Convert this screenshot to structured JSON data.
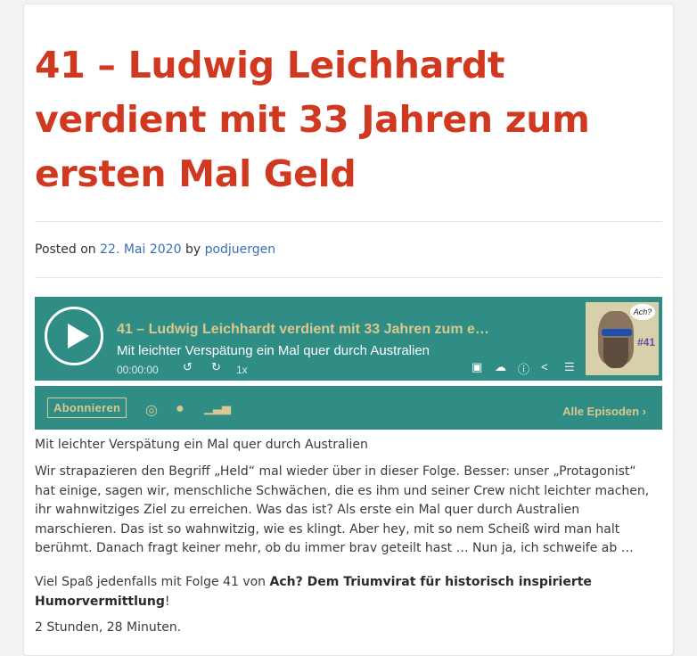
{
  "post": {
    "title": "41 – Ludwig Leichhardt verdient mit 33 Jahren zum ersten Mal Geld",
    "posted_on_label": "Posted on",
    "date": "22. Mai 2020",
    "by_label": "by",
    "author": "podjuergen"
  },
  "player": {
    "episode_title": "41 – Ludwig Leichhardt verdient mit 33 Jahren zum erste…",
    "subtitle": "Mit leichter Verspätung ein Mal quer durch Australien",
    "time": "00:00:00",
    "speed": "1x",
    "cover_number": "#41",
    "cover_bubble": "Ach?",
    "icons": [
      "play-icon",
      "rewind-icon",
      "forward-icon",
      "chapters-icon",
      "download-icon",
      "info-icon",
      "share-icon",
      "playlist-icon"
    ]
  },
  "subscribe": {
    "button_label": "Abonnieren",
    "all_episodes": "Alle Episoden ›",
    "icons": [
      "apple-podcasts-icon",
      "spotify-icon",
      "deezer-icon"
    ]
  },
  "body": {
    "lead": "Mit leichter Verspätung ein Mal quer durch Australien",
    "para1": "Wir strapazieren den Begriff „Held“ mal wieder über in dieser Folge. Besser: unser „Protagonist“ hat einige, sagen wir, menschliche Schwächen, die es ihm und seiner Crew nicht leichter machen, ihr wahnwitziges Ziel zu erreichen. Was das ist? Als erste ein Mal quer durch Australien marschieren. Das ist so wahnwitzig, wie es klingt. Aber hey, mit so nem Scheiß wird man halt berühmt. Danach fragt keiner mehr, ob du immer brav geteilt hast … Nun ja, ich schweife ab …",
    "para2_pre": "Viel Spaß jedenfalls mit Folge 41 von ",
    "para2_bold": "Ach? Dem Triumvirat für historisch inspirierte Humorvermittlung",
    "para2_post": "!",
    "duration": "2 Stunden, 28 Minuten."
  },
  "colors": {
    "title": "#d0391f",
    "player_bg": "#2f8d86",
    "accent": "#d8c98f",
    "link": "#3b6fb5"
  }
}
